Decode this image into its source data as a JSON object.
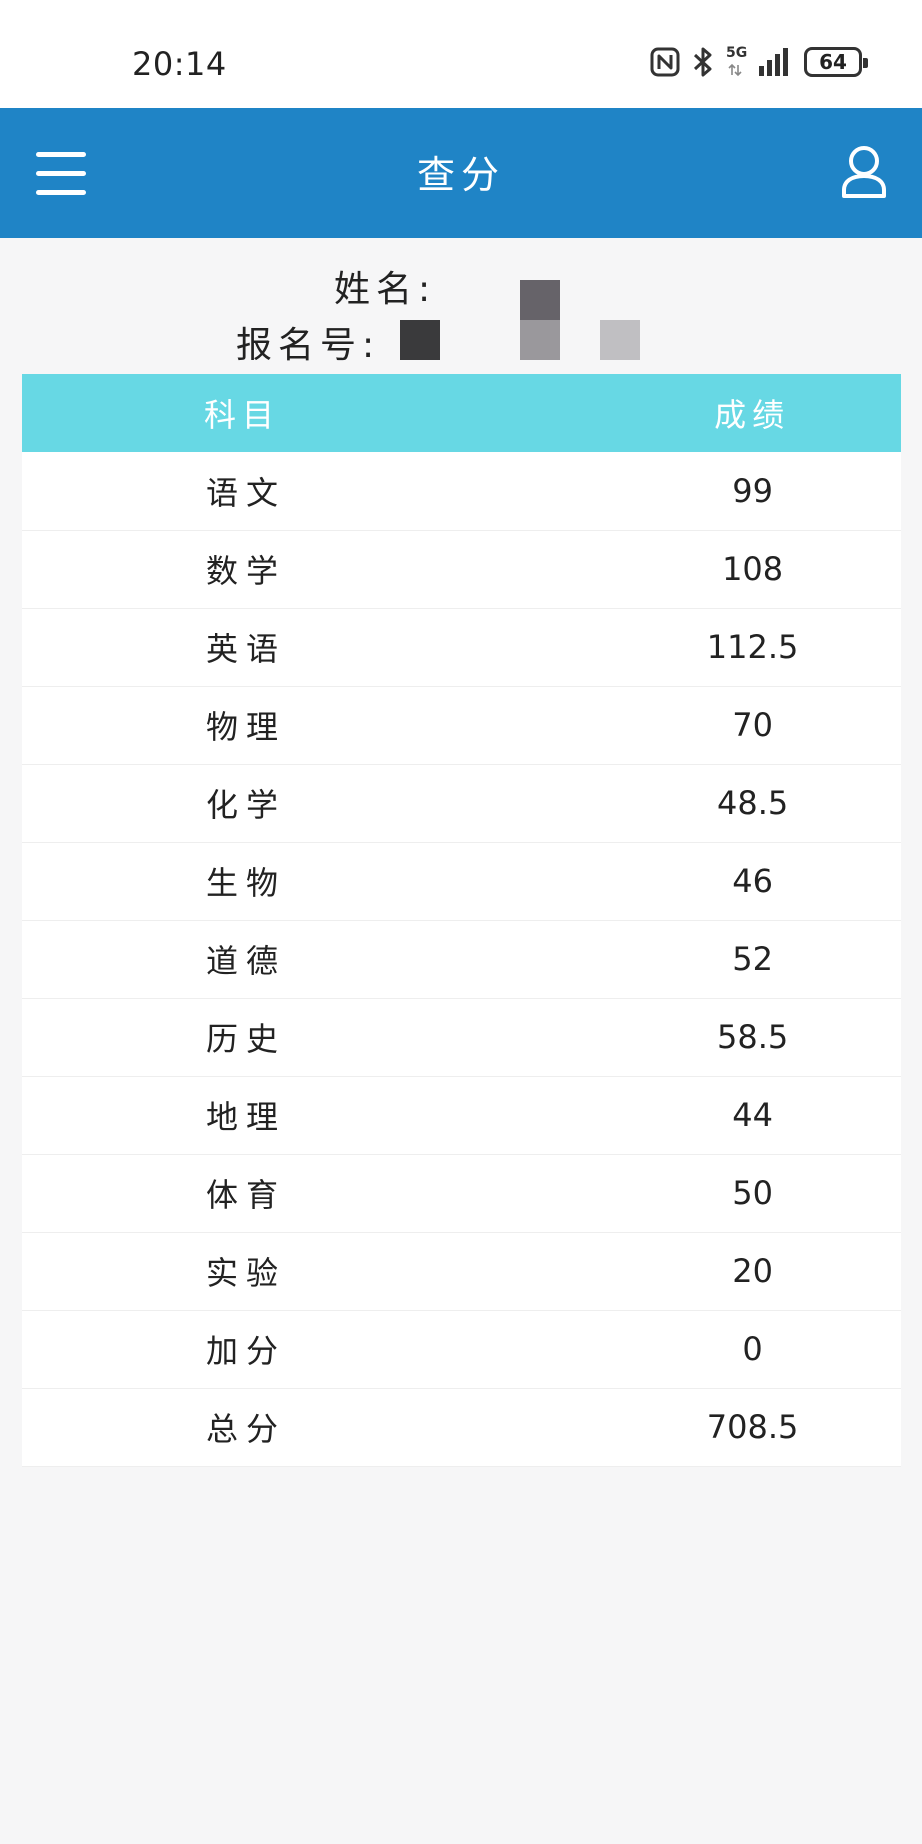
{
  "status_bar": {
    "time": "20:14",
    "network": "5G",
    "battery": "64",
    "icons": [
      "nfc-icon",
      "bluetooth-icon",
      "signal-icon",
      "battery-icon"
    ]
  },
  "header": {
    "title": "查分",
    "menu_icon": "menu-icon",
    "user_icon": "user-icon",
    "background": "#1f84c6"
  },
  "candidate": {
    "name_label": "姓名:",
    "regno_label": "报名号:"
  },
  "table": {
    "header_color": "#67d8e4",
    "columns": [
      "科目",
      "成绩"
    ],
    "rows": [
      {
        "subject": "语文",
        "score": "99"
      },
      {
        "subject": "数学",
        "score": "108"
      },
      {
        "subject": "英语",
        "score": "112.5"
      },
      {
        "subject": "物理",
        "score": "70"
      },
      {
        "subject": "化学",
        "score": "48.5"
      },
      {
        "subject": "生物",
        "score": "46"
      },
      {
        "subject": "道德",
        "score": "52"
      },
      {
        "subject": "历史",
        "score": "58.5"
      },
      {
        "subject": "地理",
        "score": "44"
      },
      {
        "subject": "体育",
        "score": "50"
      },
      {
        "subject": "实验",
        "score": "20"
      },
      {
        "subject": "加分",
        "score": "0"
      },
      {
        "subject": "总分",
        "score": "708.5"
      }
    ]
  }
}
